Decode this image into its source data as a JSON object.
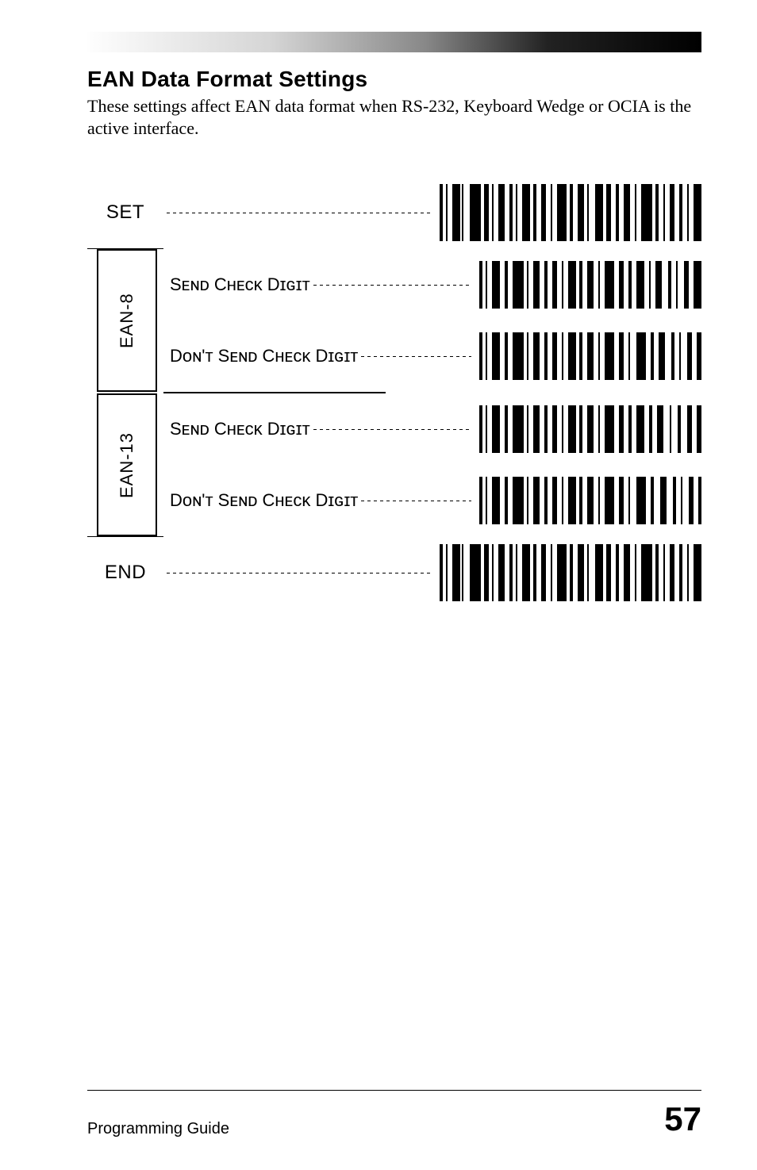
{
  "header": {
    "title": "EAN Data Format Settings",
    "description": "These settings affect EAN data format when RS-232, Keyboard Wedge or OCIA is the active interface."
  },
  "rows": {
    "set": "SET",
    "end": "END"
  },
  "groups": [
    {
      "name": "EAN-8",
      "options": [
        {
          "label": "Sᴇɴᴅ Cʜᴇᴄᴋ Dɪɢɪᴛ"
        },
        {
          "label": "Dᴏɴ'ᴛ Sᴇɴᴅ Cʜᴇᴄᴋ Dɪɢɪᴛ"
        }
      ]
    },
    {
      "name": "EAN-13",
      "options": [
        {
          "label": "Sᴇɴᴅ Cʜᴇᴄᴋ Dɪɢɪᴛ"
        },
        {
          "label": "Dᴏɴ'ᴛ Sᴇɴᴅ Cʜᴇᴄᴋ Dɪɢɪᴛ"
        }
      ]
    }
  ],
  "footer": {
    "left": "Programming Guide",
    "page": "57"
  }
}
